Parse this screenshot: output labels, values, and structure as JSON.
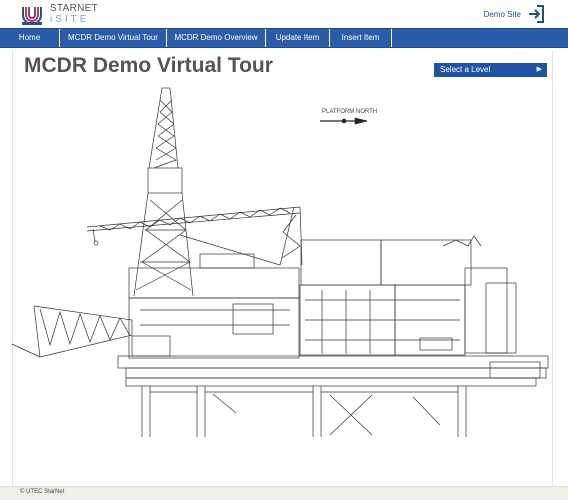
{
  "header": {
    "logo_line1": "STARNET",
    "logo_line2": "iSITE",
    "site_link": "Demo Site",
    "logout_icon": "logout-icon"
  },
  "nav": {
    "items": [
      {
        "label": "Home"
      },
      {
        "label": "MCDR Demo Virtual Tour"
      },
      {
        "label": "MCDR Demo Overview"
      },
      {
        "label": "Update Item"
      },
      {
        "label": "Insert Item"
      }
    ]
  },
  "main": {
    "title": "MCDR Demo Virtual Tour",
    "level_select": "Select a Level",
    "compass_label": "PLATFORM NORTH"
  },
  "footer": {
    "copyright": "© UTEC StarNet"
  },
  "colors": {
    "nav_bg": "#2a5caa",
    "select_bg": "#1f53a6",
    "title": "#555555"
  }
}
